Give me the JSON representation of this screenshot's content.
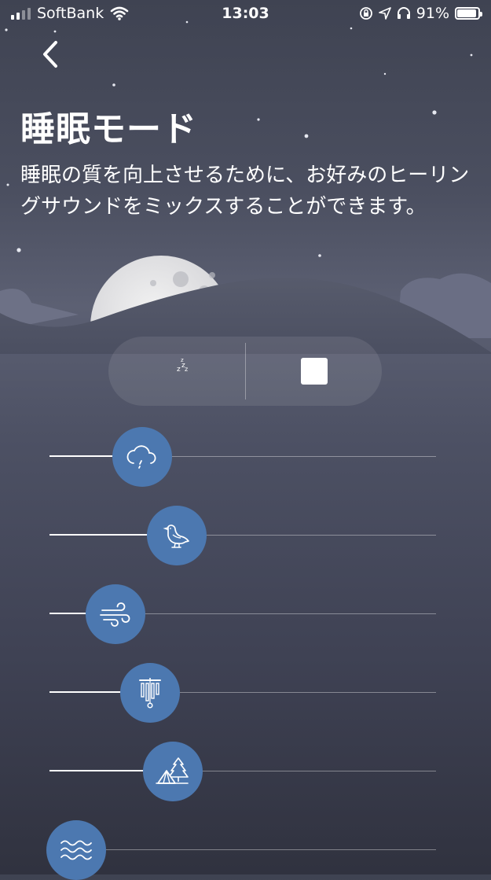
{
  "status_bar": {
    "carrier": "SoftBank",
    "time": "13:03",
    "battery_percent": "91%",
    "battery_level": 0.91
  },
  "header": {
    "title": "睡眠モード",
    "description": "睡眠の質を向上させるために、お好みのヒーリングサウンドをミックスすることができます。"
  },
  "controls": {
    "sleep_timer_icon": "moon-zzz-icon",
    "stop_icon": "stop-icon"
  },
  "sounds": [
    {
      "name": "rain",
      "icon": "rain-cloud-icon",
      "volume": 0.24
    },
    {
      "name": "bird",
      "icon": "bird-icon",
      "volume": 0.33
    },
    {
      "name": "wind",
      "icon": "wind-icon",
      "volume": 0.17
    },
    {
      "name": "wind-chime",
      "icon": "wind-chime-icon",
      "volume": 0.26
    },
    {
      "name": "camping",
      "icon": "tent-tree-icon",
      "volume": 0.32
    },
    {
      "name": "waves",
      "icon": "waves-icon",
      "volume": 0.07
    }
  ],
  "colors": {
    "knob": "#4c78b0",
    "background_top": "#3f4352",
    "background_bottom": "#30323f"
  }
}
